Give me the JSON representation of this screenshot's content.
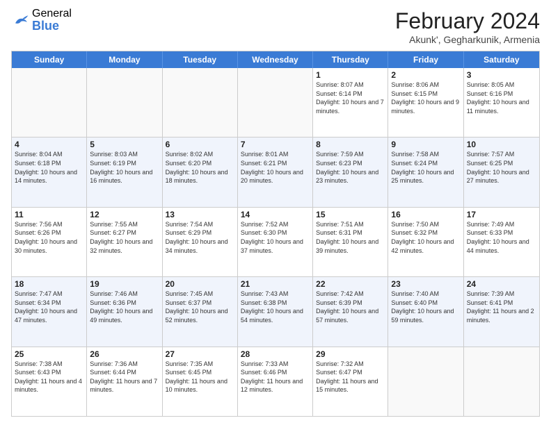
{
  "logo": {
    "general": "General",
    "blue": "Blue"
  },
  "title": "February 2024",
  "subtitle": "Akunk', Gegharkunik, Armenia",
  "header_days": [
    "Sunday",
    "Monday",
    "Tuesday",
    "Wednesday",
    "Thursday",
    "Friday",
    "Saturday"
  ],
  "rows": [
    {
      "alt": false,
      "cells": [
        {
          "empty": true
        },
        {
          "empty": true
        },
        {
          "empty": true
        },
        {
          "empty": true
        },
        {
          "day": "1",
          "sunrise": "8:07 AM",
          "sunset": "6:14 PM",
          "daylight": "10 hours and 7 minutes."
        },
        {
          "day": "2",
          "sunrise": "8:06 AM",
          "sunset": "6:15 PM",
          "daylight": "10 hours and 9 minutes."
        },
        {
          "day": "3",
          "sunrise": "8:05 AM",
          "sunset": "6:16 PM",
          "daylight": "10 hours and 11 minutes."
        }
      ]
    },
    {
      "alt": true,
      "cells": [
        {
          "day": "4",
          "sunrise": "8:04 AM",
          "sunset": "6:18 PM",
          "daylight": "10 hours and 14 minutes."
        },
        {
          "day": "5",
          "sunrise": "8:03 AM",
          "sunset": "6:19 PM",
          "daylight": "10 hours and 16 minutes."
        },
        {
          "day": "6",
          "sunrise": "8:02 AM",
          "sunset": "6:20 PM",
          "daylight": "10 hours and 18 minutes."
        },
        {
          "day": "7",
          "sunrise": "8:01 AM",
          "sunset": "6:21 PM",
          "daylight": "10 hours and 20 minutes."
        },
        {
          "day": "8",
          "sunrise": "7:59 AM",
          "sunset": "6:23 PM",
          "daylight": "10 hours and 23 minutes."
        },
        {
          "day": "9",
          "sunrise": "7:58 AM",
          "sunset": "6:24 PM",
          "daylight": "10 hours and 25 minutes."
        },
        {
          "day": "10",
          "sunrise": "7:57 AM",
          "sunset": "6:25 PM",
          "daylight": "10 hours and 27 minutes."
        }
      ]
    },
    {
      "alt": false,
      "cells": [
        {
          "day": "11",
          "sunrise": "7:56 AM",
          "sunset": "6:26 PM",
          "daylight": "10 hours and 30 minutes."
        },
        {
          "day": "12",
          "sunrise": "7:55 AM",
          "sunset": "6:27 PM",
          "daylight": "10 hours and 32 minutes."
        },
        {
          "day": "13",
          "sunrise": "7:54 AM",
          "sunset": "6:29 PM",
          "daylight": "10 hours and 34 minutes."
        },
        {
          "day": "14",
          "sunrise": "7:52 AM",
          "sunset": "6:30 PM",
          "daylight": "10 hours and 37 minutes."
        },
        {
          "day": "15",
          "sunrise": "7:51 AM",
          "sunset": "6:31 PM",
          "daylight": "10 hours and 39 minutes."
        },
        {
          "day": "16",
          "sunrise": "7:50 AM",
          "sunset": "6:32 PM",
          "daylight": "10 hours and 42 minutes."
        },
        {
          "day": "17",
          "sunrise": "7:49 AM",
          "sunset": "6:33 PM",
          "daylight": "10 hours and 44 minutes."
        }
      ]
    },
    {
      "alt": true,
      "cells": [
        {
          "day": "18",
          "sunrise": "7:47 AM",
          "sunset": "6:34 PM",
          "daylight": "10 hours and 47 minutes."
        },
        {
          "day": "19",
          "sunrise": "7:46 AM",
          "sunset": "6:36 PM",
          "daylight": "10 hours and 49 minutes."
        },
        {
          "day": "20",
          "sunrise": "7:45 AM",
          "sunset": "6:37 PM",
          "daylight": "10 hours and 52 minutes."
        },
        {
          "day": "21",
          "sunrise": "7:43 AM",
          "sunset": "6:38 PM",
          "daylight": "10 hours and 54 minutes."
        },
        {
          "day": "22",
          "sunrise": "7:42 AM",
          "sunset": "6:39 PM",
          "daylight": "10 hours and 57 minutes."
        },
        {
          "day": "23",
          "sunrise": "7:40 AM",
          "sunset": "6:40 PM",
          "daylight": "10 hours and 59 minutes."
        },
        {
          "day": "24",
          "sunrise": "7:39 AM",
          "sunset": "6:41 PM",
          "daylight": "11 hours and 2 minutes."
        }
      ]
    },
    {
      "alt": false,
      "cells": [
        {
          "day": "25",
          "sunrise": "7:38 AM",
          "sunset": "6:43 PM",
          "daylight": "11 hours and 4 minutes."
        },
        {
          "day": "26",
          "sunrise": "7:36 AM",
          "sunset": "6:44 PM",
          "daylight": "11 hours and 7 minutes."
        },
        {
          "day": "27",
          "sunrise": "7:35 AM",
          "sunset": "6:45 PM",
          "daylight": "11 hours and 10 minutes."
        },
        {
          "day": "28",
          "sunrise": "7:33 AM",
          "sunset": "6:46 PM",
          "daylight": "11 hours and 12 minutes."
        },
        {
          "day": "29",
          "sunrise": "7:32 AM",
          "sunset": "6:47 PM",
          "daylight": "11 hours and 15 minutes."
        },
        {
          "empty": true
        },
        {
          "empty": true
        }
      ]
    }
  ]
}
